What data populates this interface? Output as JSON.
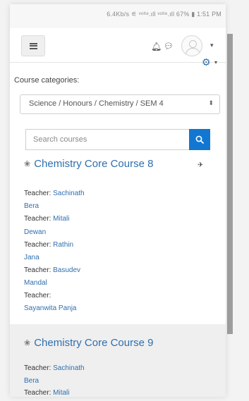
{
  "statusbar": {
    "text": "6.4Kb/s ⚟ ᵛᵒˡᵗᵉ.ıll ᵛᵒˡᵗᵉ.ıll 67% ▮ 1:51 PM"
  },
  "navbar": {
    "menu_icon": "hamburger-icon",
    "notifications_icon": "bell-icon",
    "messages_icon": "chat-icon",
    "user_icon": "avatar-icon",
    "user_caret": "▾"
  },
  "settings": {
    "icon": "gear-icon",
    "caret": "▾"
  },
  "categories": {
    "label": "Course categories:",
    "selected": "Science / Honours / Chemistry / SEM 4",
    "arrow": "⬍"
  },
  "search": {
    "placeholder": "Search courses"
  },
  "courses": [
    {
      "title": "Chemistry Core Course 8",
      "lines": [
        {
          "label": "",
          "name": ""
        },
        {
          "label": "Teacher: ",
          "name": "Sachinath"
        },
        {
          "label": "",
          "name": "Bera"
        },
        {
          "label": "Teacher: ",
          "name": "Mitali"
        },
        {
          "label": "",
          "name": "Dewan"
        },
        {
          "label": "Teacher: ",
          "name": "Rathin"
        },
        {
          "label": "",
          "name": "Jana"
        },
        {
          "label": "Teacher: ",
          "name": "Basudev"
        },
        {
          "label": "",
          "name": "Mandal"
        },
        {
          "label": "Teacher:",
          "name": ""
        },
        {
          "label": "",
          "name": "Sayanwita Panja"
        }
      ]
    },
    {
      "title": "Chemistry Core Course 9",
      "lines": [
        {
          "label": "Teacher: ",
          "name": "Sachinath"
        },
        {
          "label": "",
          "name": "Bera"
        },
        {
          "label": "Teacher: ",
          "name": "Mitali"
        }
      ]
    }
  ],
  "colors": {
    "link": "#2f6fae",
    "search_button": "#1177d1"
  }
}
